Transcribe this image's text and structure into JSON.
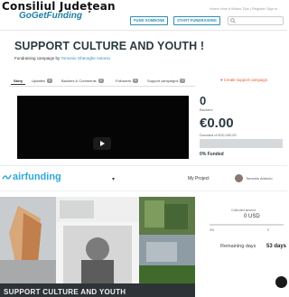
{
  "header": {
    "overlay_title": "Consiliul Județean",
    "logo_text": "GoGetFunding",
    "toplinks": "Home  How it Works  Tips  |  Register  Sign in",
    "fund_someone": "FUND SOMEONE",
    "start_fundraising": "START FUNDRAISING"
  },
  "campaign": {
    "title": "SUPPORT CULTURE AND YOUTH !",
    "subtitle_prefix": "Fundraising campaign by",
    "author": "Tomoniu Gheorghe Antonio"
  },
  "tabs": [
    {
      "label": "Story",
      "badge": ""
    },
    {
      "label": "Updates",
      "badge": "0"
    },
    {
      "label": "Backers & Comments",
      "badge": "0"
    },
    {
      "label": "Followers",
      "badge": "0"
    },
    {
      "label": "Support campaigns",
      "badge": "0"
    }
  ],
  "create_support": "Create support campaign",
  "stats": {
    "backers_count": "0",
    "backers_label": "Backers",
    "donated": "€0.00",
    "donated_of": "Donated of €20,000.00",
    "funded_label": "0% Funded",
    "funded_fraction": 0
  },
  "airfunding": {
    "brand": "airfunding",
    "my_project": "My Project",
    "user_name": "Tomoniu Antonio"
  },
  "sidepanel": {
    "collected_label": "Collected amount",
    "collected_amount": "0 USD",
    "left_value": "0%",
    "right_value": "0",
    "remaining_label": "Remaining days",
    "remaining_days": "53 days"
  },
  "gallery_caption": "SUPPORT CULTURE AND YOUTH",
  "colors": {
    "accent": "#2d8fb5",
    "brand_air": "#2ea8d8",
    "create_support": "#e55a2b",
    "title_dark": "#2b3a42"
  }
}
